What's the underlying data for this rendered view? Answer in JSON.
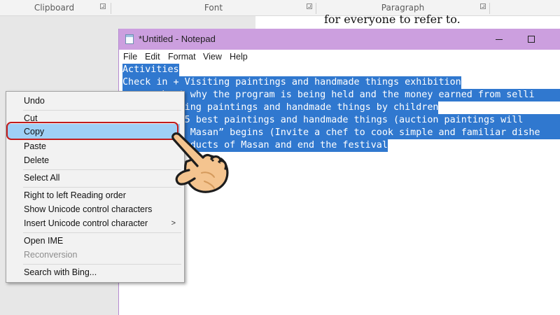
{
  "ribbon": {
    "groups": [
      {
        "label": "Clipboard"
      },
      {
        "label": "Font"
      },
      {
        "label": "Paragraph"
      }
    ]
  },
  "document": {
    "visible_text": "for everyone to refer to."
  },
  "notepad": {
    "title": "*Untitled - Notepad",
    "menu": [
      "File",
      "Edit",
      "Format",
      "View",
      "Help"
    ],
    "lines": [
      "Activities",
      "Check in + Visiting paintings and handmade things exhibition",
      "       bout why the program is being held and the money earned from selli",
      "       selling paintings and handmade things by children",
      "       the 5 best paintings and handmade things (auction paintings will",
      "        ing Masan” begins (Invite a chef to cook simple and familiar dishe",
      "         products of Masan and end the festival"
    ]
  },
  "context_menu": {
    "items": [
      {
        "label": "Undo",
        "enabled": true
      },
      {
        "label": "Cut",
        "enabled": true
      },
      {
        "label": "Copy",
        "enabled": true,
        "highlighted": true
      },
      {
        "label": "Paste",
        "enabled": true
      },
      {
        "label": "Delete",
        "enabled": true
      },
      {
        "label": "Select All",
        "enabled": true
      },
      {
        "label": "Right to left Reading order",
        "enabled": true
      },
      {
        "label": "Show Unicode control characters",
        "enabled": true
      },
      {
        "label": "Insert Unicode control character",
        "enabled": true,
        "submenu": true
      },
      {
        "label": "Open IME",
        "enabled": true
      },
      {
        "label": "Reconversion",
        "enabled": false
      },
      {
        "label": "Search with Bing...",
        "enabled": true
      }
    ],
    "submenu_icon": "chevron-right-icon"
  },
  "icons": [
    "dialog-launcher-icon",
    "notepad-icon",
    "minimize-icon",
    "maximize-icon",
    "hand-pointer-icon"
  ],
  "colors": {
    "selection": "#3078cf",
    "notepad_titlebar": "#cc9fdf",
    "menu_highlight": "#9fd0f6",
    "callout_ring": "#c21b1b"
  }
}
